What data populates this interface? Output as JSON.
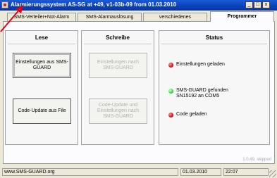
{
  "window": {
    "title": "Alarmierungssystem AS-SG at +49, v1-03b-09 from 01.03.2010",
    "minimize_label": "_",
    "maximize_label": "□",
    "close_label": "x"
  },
  "tabs": [
    {
      "label": "SMS-Verteiler+Not-Alarm",
      "active": false
    },
    {
      "label": "SMS-Alarmauslösung",
      "active": false
    },
    {
      "label": "verschiedenes",
      "active": false
    },
    {
      "label": "Programmer",
      "active": true
    }
  ],
  "lese": {
    "title": "Lese",
    "button1": "Einstellungen aus SMS-GUARD",
    "button2": "Code-Update aus File"
  },
  "schreibe": {
    "title": "Schreibe",
    "button1": "Einstellungen nach SMS-GUARD",
    "button2": "Code-Update und Einstellungen nach SMS-GUARD"
  },
  "status": {
    "title": "Status",
    "items": [
      {
        "led": "red",
        "text": "Einstellungen geladen"
      },
      {
        "led": "green",
        "text": "SMS-GUARD gefunden\nSN15192 an COM5"
      },
      {
        "led": "red",
        "text": "Code geladen"
      }
    ]
  },
  "version": "1.0.49, skipped",
  "statusbar": {
    "website": "www.SMS-GUARD.org",
    "date": "01.03.2010",
    "time": "22:07"
  },
  "colors": {
    "titlebar": "#0a3fb8",
    "led_red": "#d11212",
    "led_green": "#35d835",
    "arrow": "#e0001a"
  }
}
